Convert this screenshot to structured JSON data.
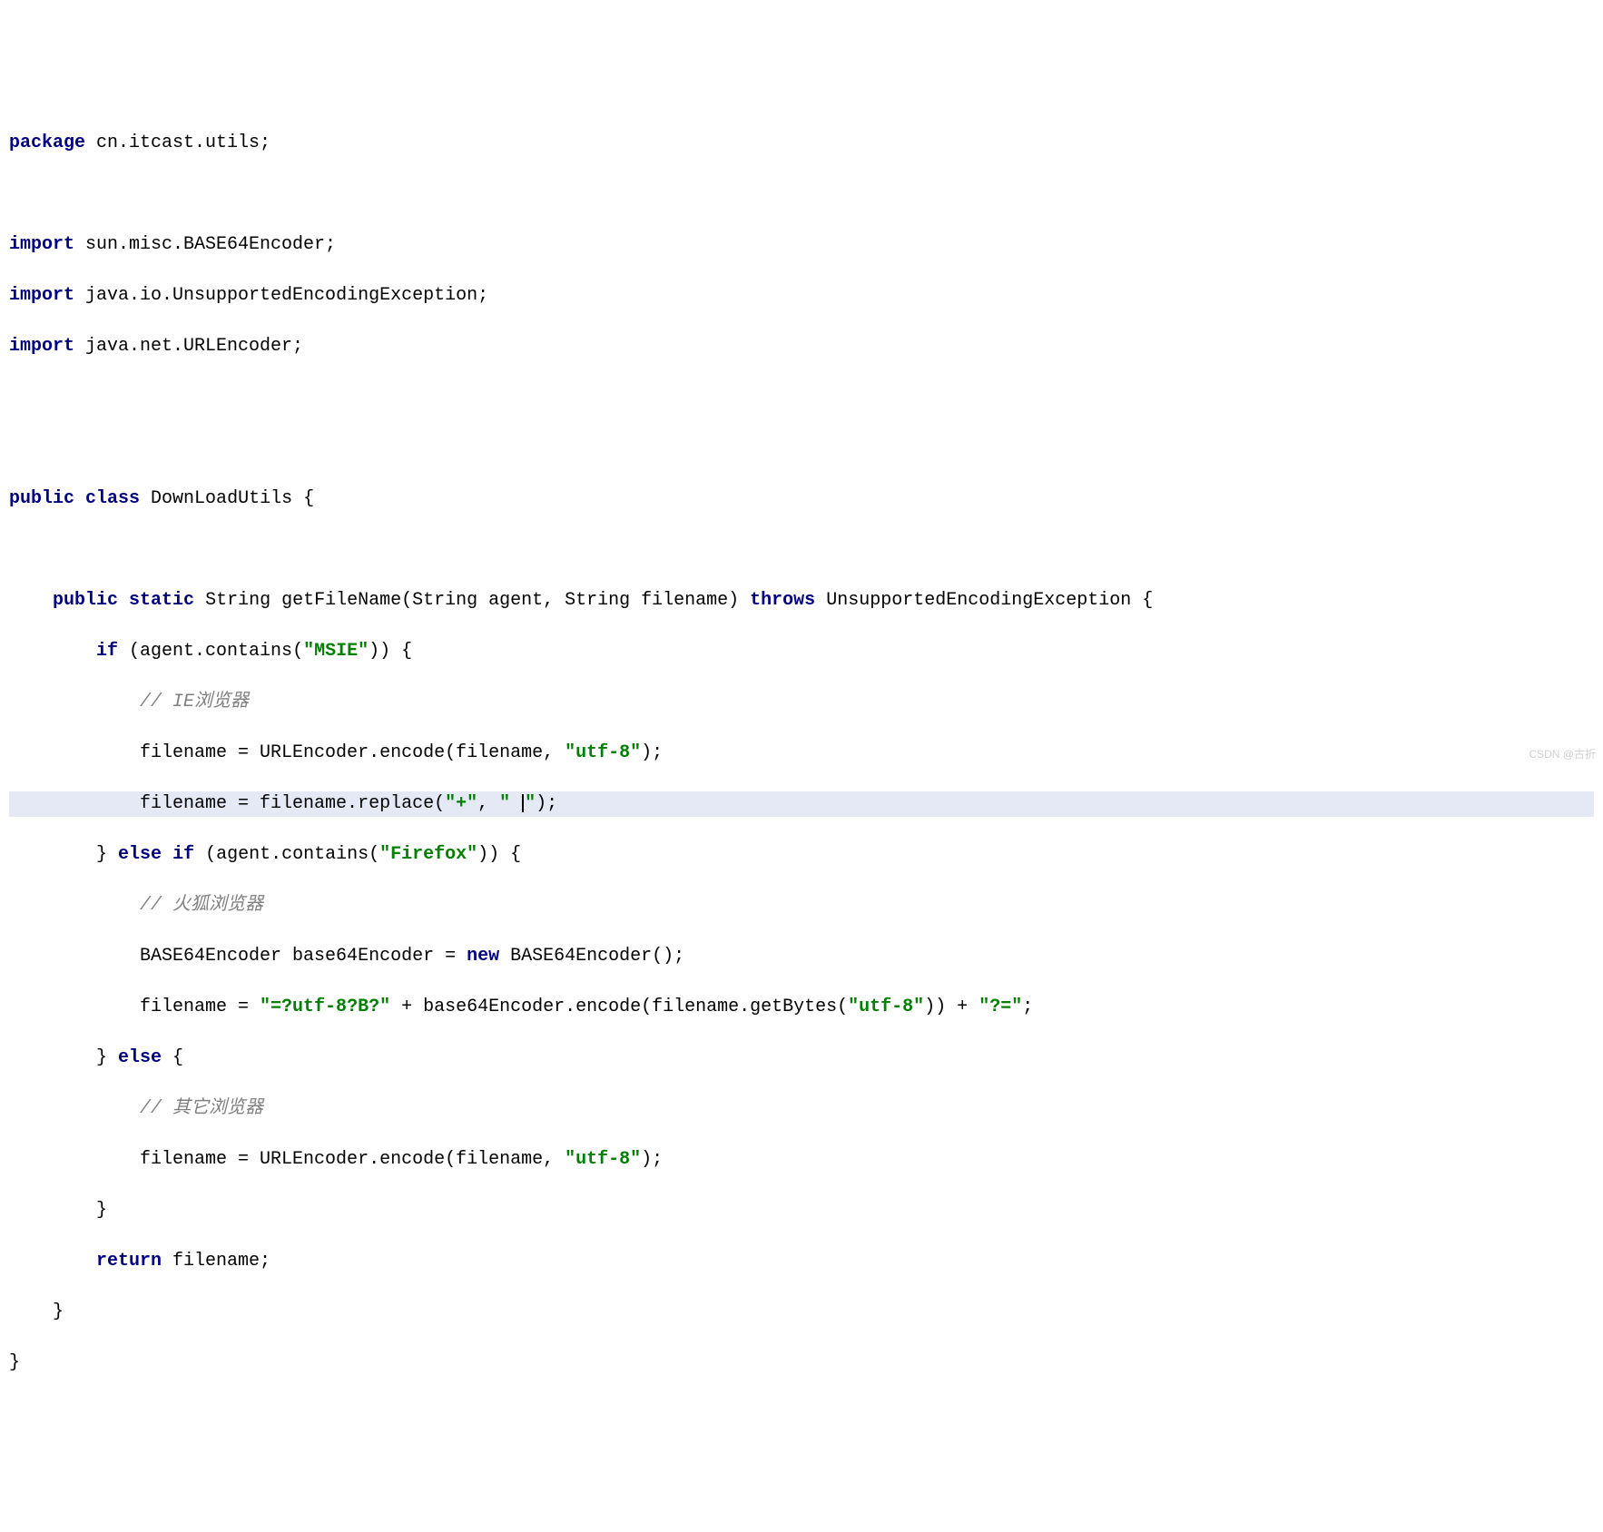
{
  "code": {
    "kw_package": "package",
    "pkg_name": " cn.itcast.utils;",
    "kw_import": "import",
    "imp1": " sun.misc.BASE64Encoder;",
    "imp2": " java.io.UnsupportedEncodingException;",
    "imp3": " java.net.URLEncoder;",
    "kw_public": "public",
    "kw_class": "class",
    "class_decl": " DownLoadUtils {",
    "kw_static": "static",
    "method_sig_a": " String getFileName(String agent, String filename) ",
    "kw_throws": "throws",
    "method_sig_b": " UnsupportedEncodingException {",
    "kw_if": "if",
    "if_cond_a": " (agent.contains(",
    "str_msie": "\"MSIE\"",
    "if_cond_b": ")) {",
    "cmt_ie": "// IE浏览器",
    "ie_line1_a": "            filename = URLEncoder.encode(filename, ",
    "str_utf8": "\"utf-8\"",
    "ie_line1_b": ");",
    "ie_line2_a": "            filename = filename.replace(",
    "str_plus": "\"+\"",
    "comma_sp": ", ",
    "str_space_a": "\" ",
    "str_space_b": "\"",
    "ie_line2_b": ");",
    "kw_else": "else",
    "elseif_a": " (agent.contains(",
    "str_firefox": "\"Firefox\"",
    "elseif_b": ")) {",
    "cmt_ff": "// 火狐浏览器",
    "ff_line1_a": "            BASE64Encoder base64Encoder = ",
    "kw_new": "new",
    "ff_line1_b": " BASE64Encoder();",
    "ff_line2_a": "            filename = ",
    "str_prefix": "\"=?utf-8?B?\"",
    "ff_line2_b": " + base64Encoder.encode(filename.getBytes(",
    "ff_line2_c": ")) + ",
    "str_suffix": "\"?=\"",
    "ff_line2_d": ";",
    "else_open": " {",
    "cmt_other": "// 其它浏览器",
    "other_line_a": "            filename = URLEncoder.encode(filename, ",
    "other_line_b": ");",
    "close_inner": "        }",
    "kw_return": "return",
    "ret_stmt": " filename;",
    "close_method": "    }",
    "close_class": "}",
    "else_brace_close": "} ",
    "indent8": "        ",
    "indent4": "    ",
    "space": " "
  },
  "watermark": "CSDN @古折"
}
